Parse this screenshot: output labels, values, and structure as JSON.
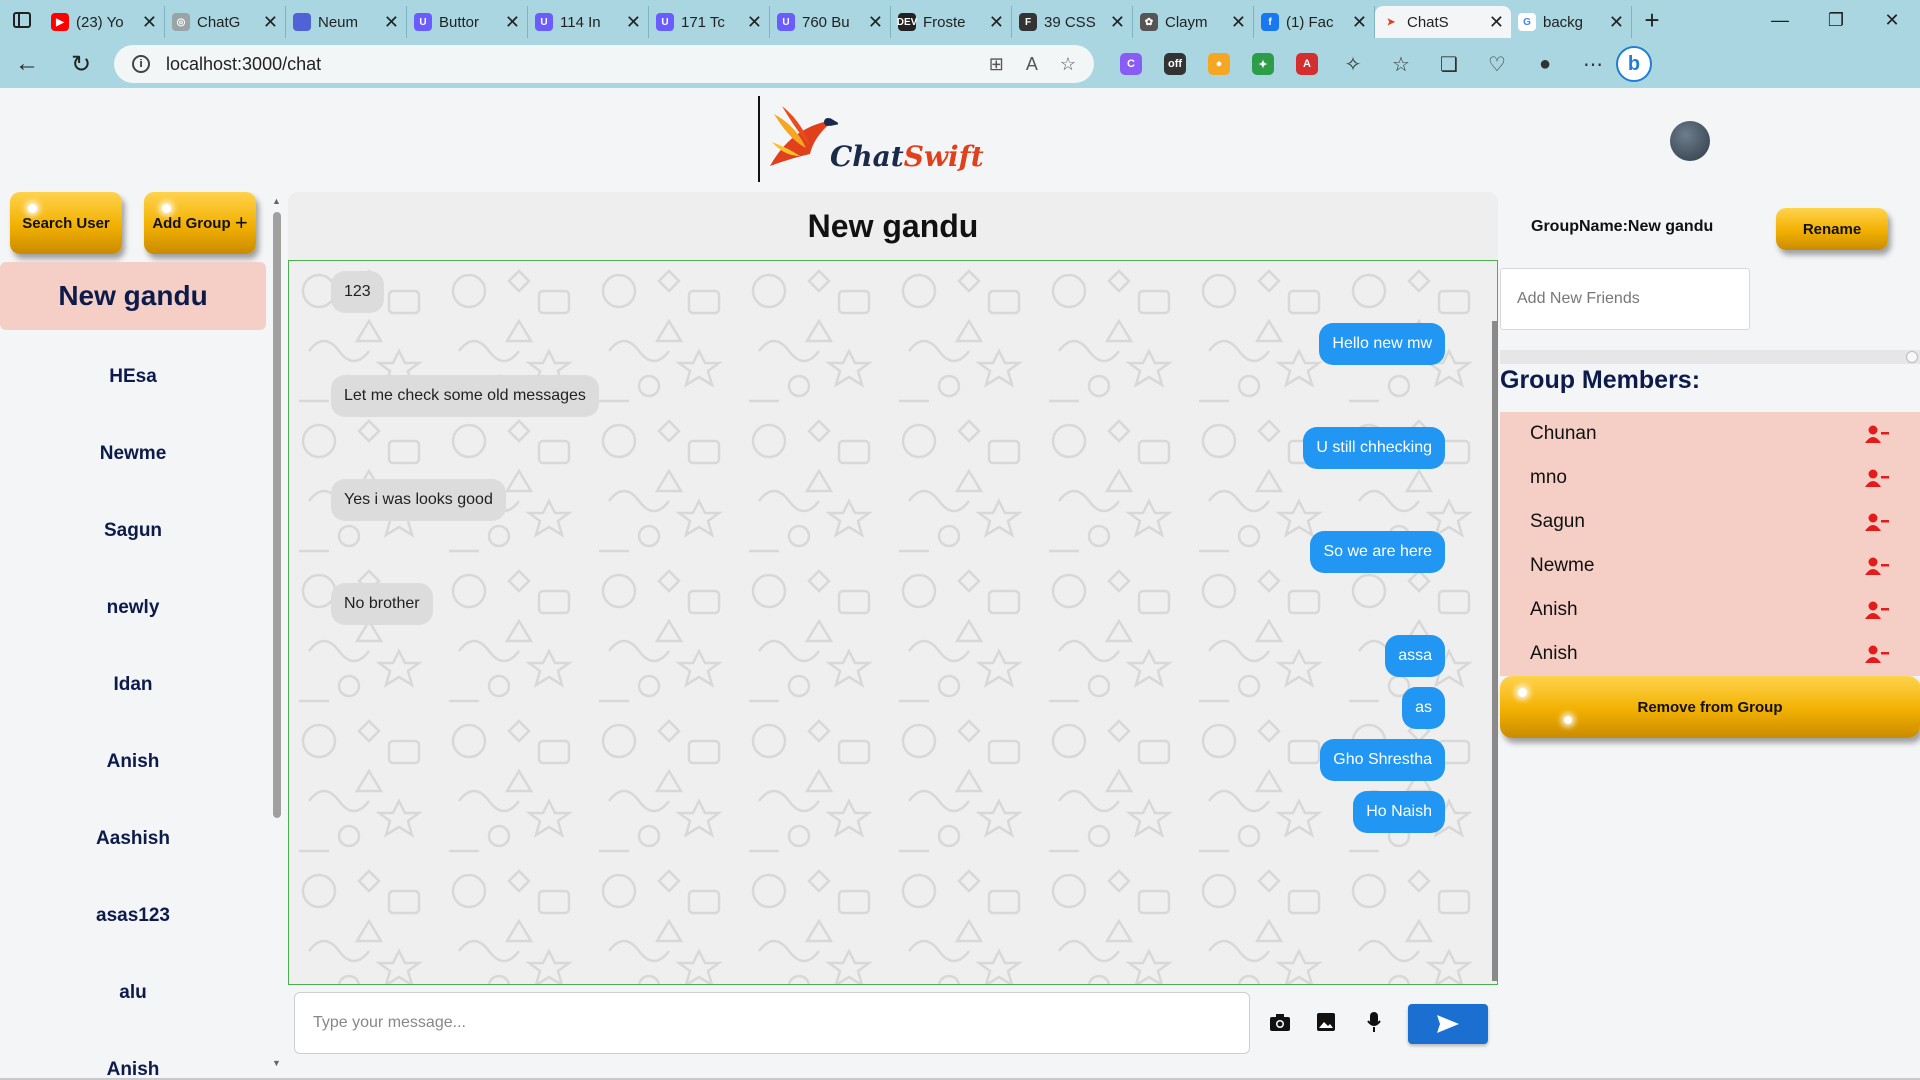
{
  "browser": {
    "tabs": [
      {
        "title": "(23) Yo",
        "icon": "youtube-icon",
        "color": "#ff0000",
        "glyph": "▶"
      },
      {
        "title": "ChatG",
        "icon": "chatgpt-icon",
        "color": "#9aa3a6",
        "glyph": "◎"
      },
      {
        "title": "Neum",
        "icon": "neumorphism-icon",
        "color": "#4f63d6",
        "glyph": ""
      },
      {
        "title": "Buttor",
        "icon": "uiverse-icon",
        "color": "#6b5cff",
        "glyph": "U"
      },
      {
        "title": "114 In",
        "icon": "uiverse-icon",
        "color": "#6b5cff",
        "glyph": "U"
      },
      {
        "title": "171 Tc",
        "icon": "uiverse-icon",
        "color": "#6b5cff",
        "glyph": "U"
      },
      {
        "title": "760 Bu",
        "icon": "uiverse-icon",
        "color": "#6b5cff",
        "glyph": "U"
      },
      {
        "title": "Froste",
        "icon": "dev-icon",
        "color": "#222222",
        "glyph": "DEV"
      },
      {
        "title": "39 CSS",
        "icon": "document-icon",
        "color": "#333333",
        "glyph": "F"
      },
      {
        "title": "Claym",
        "icon": "openai-icon",
        "color": "#555555",
        "glyph": "✿"
      },
      {
        "title": "(1) Fac",
        "icon": "facebook-icon",
        "color": "#1877f2",
        "glyph": "f"
      },
      {
        "title": "ChatS",
        "icon": "chatswift-icon",
        "color": "#e0401c",
        "glyph": "➤"
      },
      {
        "title": "backg",
        "icon": "google-icon",
        "color": "#ffffff",
        "glyph": "G"
      }
    ],
    "new_tab_label": "+",
    "url": "localhost:3000/chat"
  },
  "app": {
    "logo_word_1": "Chat",
    "logo_word_2": "Swift",
    "search_user_label": "Search User",
    "add_group_label": "Add Group",
    "add_group_suffix": "+",
    "chats": [
      {
        "name": "New gandu",
        "selected": true
      },
      {
        "name": "HEsa"
      },
      {
        "name": "Newme"
      },
      {
        "name": "Sagun"
      },
      {
        "name": "newly"
      },
      {
        "name": "Idan"
      },
      {
        "name": "Anish"
      },
      {
        "name": "Aashish"
      },
      {
        "name": "asas123"
      },
      {
        "name": "alu"
      },
      {
        "name": "Anish"
      }
    ],
    "chat_title": "New gandu",
    "messages": [
      {
        "text": "123",
        "side": "in"
      },
      {
        "text": "Hello new mw",
        "side": "out"
      },
      {
        "text": "Let me check some old messages",
        "side": "in"
      },
      {
        "text": "U still chhecking",
        "side": "out"
      },
      {
        "text": "Yes i was looks good",
        "side": "in"
      },
      {
        "text": "So we are here",
        "side": "out"
      },
      {
        "text": "No brother",
        "side": "in"
      },
      {
        "text": "assa",
        "side": "out"
      },
      {
        "text": "as",
        "side": "out"
      },
      {
        "text": "Gho Shrestha",
        "side": "out"
      },
      {
        "text": "Ho Naish",
        "side": "out"
      }
    ],
    "composer_placeholder": "Type your message...",
    "group_name_label": "GroupName:",
    "group_name": "New gandu",
    "rename_label": "Rename",
    "add_friends_placeholder": "Add New Friends",
    "members_title": "Group Members:",
    "members": [
      "Chunan",
      "mno",
      "Sagun",
      "Newme",
      "Anish",
      "Anish"
    ],
    "remove_group_label": "Remove from Group",
    "colors": {
      "accent_gold": "#f2b000",
      "outgoing_bubble": "#2196f3",
      "incoming_bubble": "#dcdcdc",
      "selected_chat": "#f5cfc6",
      "send_button": "#1a6fd0",
      "remove_icon": "#e21b1b"
    }
  }
}
